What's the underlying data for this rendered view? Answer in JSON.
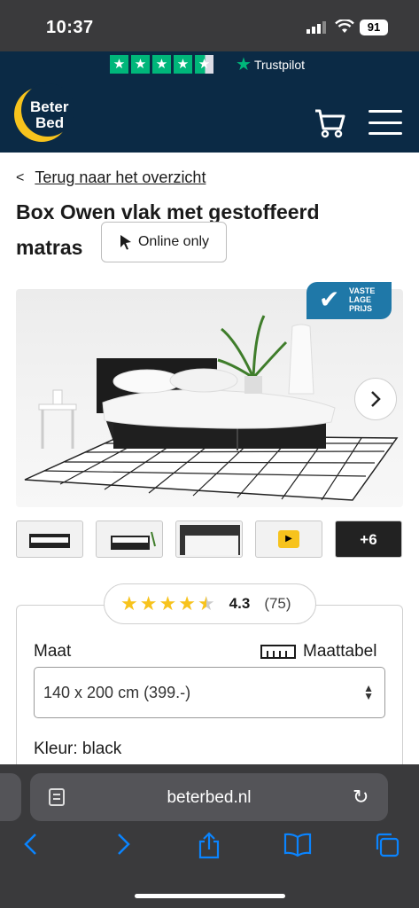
{
  "status_bar": {
    "time": "10:37",
    "battery": "91"
  },
  "trustpilot": {
    "label": "Trustpilot"
  },
  "brand": {
    "line1": "Beter",
    "line2": "Bed"
  },
  "breadcrumb": {
    "chevron": "<",
    "label": "Terug naar het overzicht"
  },
  "product": {
    "title_line1": "Box Owen vlak met gestoffeerd",
    "title_line2": "matras",
    "online_only": "Online only",
    "badge": {
      "line1": "VASTE",
      "line2": "LAGE",
      "line3": "PRIJS"
    },
    "more_images": "+6"
  },
  "rating": {
    "value": "4.3",
    "count": "(75)",
    "stars": 4.3
  },
  "config": {
    "size_label": "Maat",
    "size_table_label": "Maattabel",
    "size_value": "140 x 200 cm (399.-)",
    "color_label": "Kleur: black"
  },
  "browser": {
    "url": "beterbed.nl"
  },
  "colors": {
    "navy": "#0b2a45",
    "trustpilot_green": "#00b67a",
    "brand_yellow": "#f7c31d",
    "badge_blue": "#1f78a8",
    "ios_blue": "#0a84ff"
  },
  "icons": [
    "signal-icon",
    "wifi-icon",
    "cart-icon",
    "hamburger-icon",
    "cursor-icon",
    "check-icon",
    "chevron-right-icon",
    "play-icon",
    "ruler-icon",
    "share-icon",
    "bookmarks-icon",
    "tabs-icon",
    "reload-icon"
  ]
}
